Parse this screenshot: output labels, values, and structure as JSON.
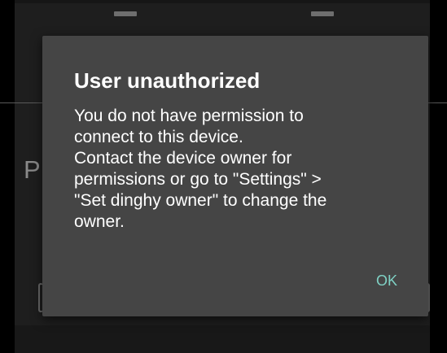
{
  "background": {
    "partial_letter": "P"
  },
  "dialog": {
    "title": "User unauthorized",
    "message_lines": [
      "You do not have permission to",
      "connect to this device.",
      "Contact the device owner for",
      "permissions or go to \"Settings\" >",
      "\"Set dinghy owner\" to change the",
      "owner."
    ],
    "ok_label": "OK"
  },
  "colors": {
    "screen_background": "#000000",
    "dialog_background": "#454545",
    "text": "#ffffff",
    "accent": "#7fd1c4"
  }
}
